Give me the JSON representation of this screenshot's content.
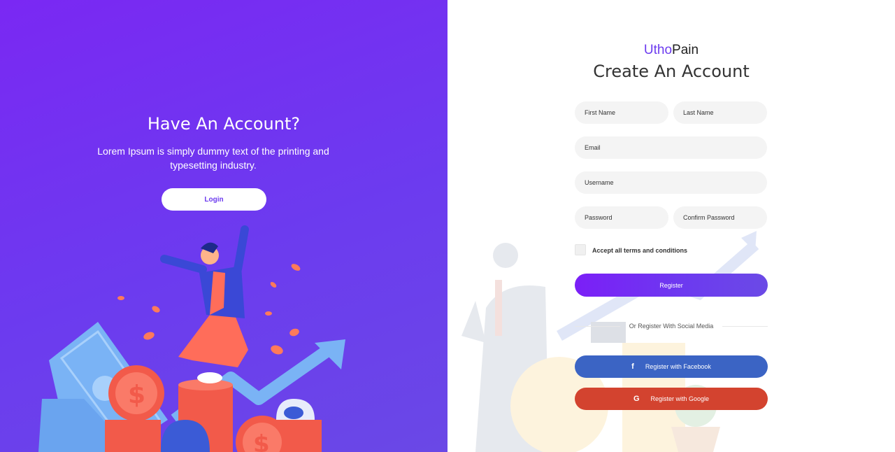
{
  "left_panel": {
    "title": "Have An Account?",
    "text": "Lorem Ipsum is simply dummy text of the printing and typesetting industry.",
    "login_label": "Login"
  },
  "right_panel": {
    "brand_part1": "Utho",
    "brand_part2": "Pain",
    "heading": "Create An Account",
    "fields": {
      "first_name": "First Name",
      "last_name": "Last Name",
      "email": "Email",
      "username": "Username",
      "password": "Password",
      "confirm_password": "Confirm Password"
    },
    "terms_label": "Accept all terms and conditions",
    "register_label": "Register",
    "divider_text": "Or Register With Social Media",
    "facebook_label": "Register with Facebook",
    "facebook_icon": "f",
    "google_label": "Register with Google",
    "google_icon": "G"
  },
  "colors": {
    "accent": "#6c3bef",
    "facebook": "#3b64c4",
    "google": "#d3432f"
  }
}
